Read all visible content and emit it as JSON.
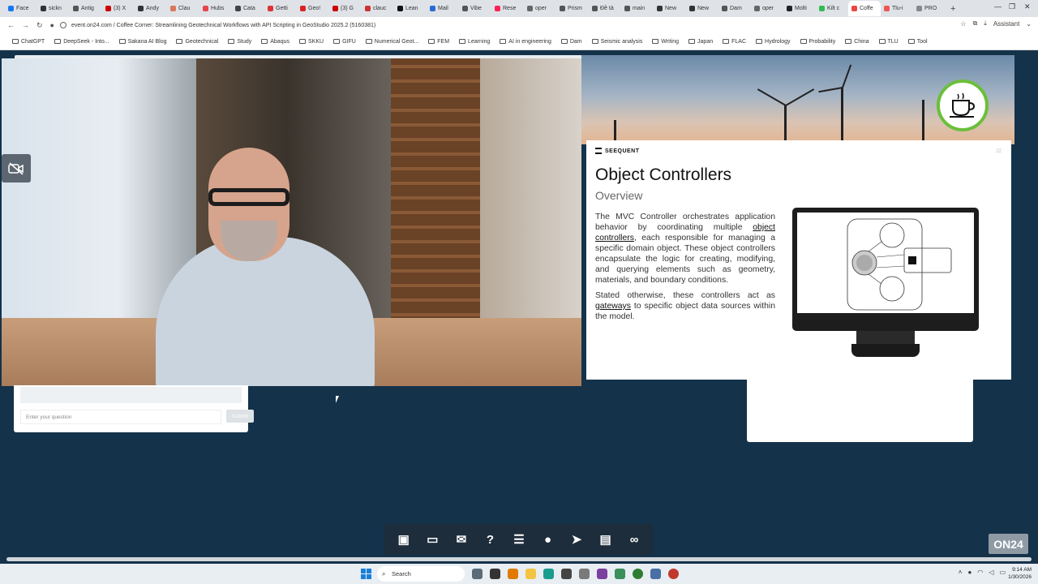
{
  "browser": {
    "tabs": [
      "Face",
      "sickn",
      "Antig",
      "(3) X",
      "Andy",
      "Clau",
      "Hubs",
      "Cata",
      "Getti",
      "Geo!",
      "(3) G",
      "clauc",
      "Lean",
      "Mail",
      "Vibe",
      "Rese",
      "oper",
      "Prism",
      "Đề tà",
      "main",
      "New",
      "New",
      "Dam",
      "oper",
      "Molti",
      "Kilt c",
      "Coffe",
      "Tlu-i",
      "PRO"
    ],
    "new_tab": "+",
    "url": "event.on24.com / Coffee Corner: Streamlining Geotechnical Workflows with API Scripting in GeoStudio 2025.2 (5160381)",
    "assistant_label": "Assistant",
    "bookmarks": [
      "ChatGPT",
      "DeepSeek - Into...",
      "Sakana AI Blog",
      "Geotechnical",
      "Study",
      "Abaqus",
      "SKKU",
      "GIFU",
      "Numerical Geot...",
      "FEM",
      "Learning",
      "AI in engineering",
      "Dam",
      "Seismic analysis",
      "Writing",
      "Japan",
      "FLAC",
      "Hydrology",
      "Probability",
      "China",
      "TLU",
      "Tool"
    ]
  },
  "slide": {
    "brand": "SEEQUENT",
    "page_number": "22",
    "title": "Object Controllers",
    "subtitle": "Overview",
    "para1_a": "The MVC Controller orchestrates application behavior by coordinating multiple ",
    "para1_link": "object controllers",
    "para1_b": ", each responsible for managing a specific domain object. These object controllers encapsulate the logic for creating, modifying, and querying elements such as geometry, materials, and boundary conditions.",
    "para2_a": "Stated otherwise, these controllers act as ",
    "para2_link": "gateways",
    "para2_b": " to specific object data sources within the model."
  },
  "qa": {
    "placeholder": "Enter your question",
    "submit": "Submit"
  },
  "brand_badge": "ON24",
  "taskbar": {
    "search_label": "Search",
    "time": "9:14 AM",
    "date": "1/30/2026"
  },
  "colors": {
    "page_bg": "#14324a",
    "toolbar_bg": "#1e2d3b",
    "badge_ring": "#6bbf3a"
  }
}
